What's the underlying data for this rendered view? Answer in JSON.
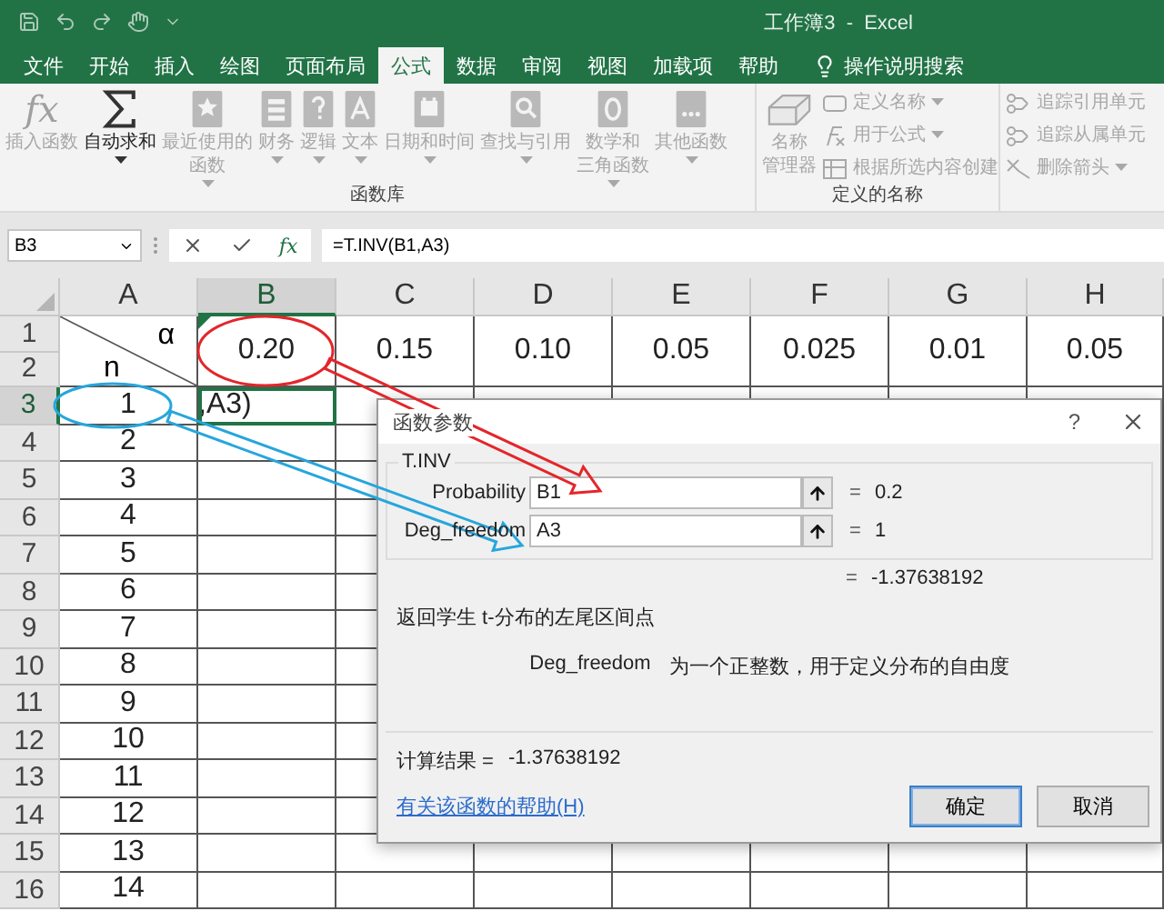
{
  "window": {
    "title": "工作簿3  -  Excel"
  },
  "menu_tabs": [
    {
      "label": "文件",
      "selected": false
    },
    {
      "label": "开始",
      "selected": false
    },
    {
      "label": "插入",
      "selected": false
    },
    {
      "label": "绘图",
      "selected": false
    },
    {
      "label": "页面布局",
      "selected": false
    },
    {
      "label": "公式",
      "selected": true
    },
    {
      "label": "数据",
      "selected": false
    },
    {
      "label": "审阅",
      "selected": false
    },
    {
      "label": "视图",
      "selected": false
    },
    {
      "label": "加载项",
      "selected": false
    },
    {
      "label": "帮助",
      "selected": false
    }
  ],
  "search": {
    "label": "操作说明搜索"
  },
  "ribbon": {
    "groups": [
      {
        "label": "函数库",
        "buttons": [
          {
            "kind": "large",
            "glyph": "fx",
            "label": "插入函数",
            "dropdown": false,
            "disabled": true
          },
          {
            "kind": "large",
            "label": "自动求和",
            "dropdown": true,
            "disabled": false
          },
          {
            "kind": "large",
            "lines": [
              "最近使用的",
              "函数"
            ],
            "dropdown": true,
            "disabled": true
          },
          {
            "kind": "large",
            "label": "财务",
            "dropdown": true,
            "disabled": true
          },
          {
            "kind": "large",
            "label": "逻辑",
            "dropdown": true,
            "disabled": true
          },
          {
            "kind": "large",
            "label": "文本",
            "dropdown": true,
            "disabled": true
          },
          {
            "kind": "large",
            "label": "日期和时间",
            "dropdown": true,
            "disabled": true
          },
          {
            "kind": "large",
            "label": "查找与引用",
            "dropdown": true,
            "disabled": true
          },
          {
            "kind": "large",
            "lines": [
              "数学和",
              "三角函数"
            ],
            "dropdown": true,
            "disabled": true
          },
          {
            "kind": "large",
            "label": "其他函数",
            "dropdown": true,
            "disabled": true
          }
        ]
      },
      {
        "label": "定义的名称",
        "buttons": [
          {
            "kind": "large",
            "lines": [
              "名称",
              "管理器"
            ],
            "dropdown": false,
            "disabled": true
          },
          {
            "kind": "small",
            "label": "定义名称",
            "dropdown": true,
            "disabled": true
          },
          {
            "kind": "small",
            "label": "用于公式",
            "dropdown": true,
            "disabled": true
          },
          {
            "kind": "small",
            "label": "根据所选内容创建",
            "dropdown": false,
            "disabled": true
          }
        ]
      },
      {
        "buttons": [
          {
            "kind": "small",
            "label": "追踪引用单元",
            "dropdown": false,
            "disabled": true
          },
          {
            "kind": "small",
            "label": "追踪从属单元",
            "dropdown": false,
            "disabled": true
          },
          {
            "kind": "small",
            "label": "删除箭头",
            "dropdown": true,
            "disabled": true
          }
        ]
      }
    ]
  },
  "formula_bar": {
    "name_box": "B3",
    "fx": "fx",
    "formula": "=T.INV(B1,A3)"
  },
  "sheet": {
    "columns": [
      {
        "label": "A",
        "selected": false
      },
      {
        "label": "B",
        "selected": true
      },
      {
        "label": "C",
        "selected": false
      },
      {
        "label": "D",
        "selected": false
      },
      {
        "label": "E",
        "selected": false
      },
      {
        "label": "F",
        "selected": false
      },
      {
        "label": "G",
        "selected": false
      },
      {
        "label": "H",
        "selected": false
      }
    ],
    "top_rows": [
      "1",
      "2"
    ],
    "header_cell": {
      "top": "α",
      "bottom": "n"
    },
    "alpha_values": [
      "0.20",
      "0.15",
      "0.10",
      "0.05",
      "0.025",
      "0.01",
      "0.05"
    ],
    "rows": [
      {
        "number": "3",
        "n": "1",
        "b": ",A3)",
        "selected": true
      },
      {
        "number": "4",
        "n": "2",
        "selected": false
      },
      {
        "number": "5",
        "n": "3",
        "selected": false
      },
      {
        "number": "6",
        "n": "4",
        "selected": false
      },
      {
        "number": "7",
        "n": "5",
        "selected": false
      },
      {
        "number": "8",
        "n": "6",
        "selected": false
      },
      {
        "number": "9",
        "n": "7",
        "selected": false
      },
      {
        "number": "10",
        "n": "8",
        "selected": false
      },
      {
        "number": "11",
        "n": "9",
        "selected": false
      },
      {
        "number": "12",
        "n": "10",
        "selected": false
      },
      {
        "number": "13",
        "n": "11",
        "selected": false
      },
      {
        "number": "14",
        "n": "12",
        "selected": false
      },
      {
        "number": "15",
        "n": "13",
        "selected": false
      },
      {
        "number": "16",
        "n": "14",
        "selected": false
      }
    ]
  },
  "dialog": {
    "title": "函数参数",
    "help": "?",
    "function": "T.INV",
    "args": [
      {
        "label": "Probability",
        "value": "B1",
        "sign": "=",
        "result": "0.2"
      },
      {
        "label": "Deg_freedom",
        "value": "A3",
        "sign": "=",
        "result": "1"
      }
    ],
    "formula_sign": "=",
    "formula_result": "-1.37638192",
    "description": "返回学生 t-分布的左尾区间点",
    "arg_name": "Deg_freedom",
    "arg_description": "为一个正整数，用于定义分布的自由度",
    "result_label": "计算结果 =",
    "result_value": "-1.37638192",
    "help_link": "有关该函数的帮助(H)",
    "buttons": [
      {
        "label": "确定",
        "focused": true
      },
      {
        "label": "取消",
        "focused": false
      }
    ]
  },
  "annotations": [
    {
      "color": "#e3262b"
    },
    {
      "color": "#26a6dc"
    }
  ]
}
